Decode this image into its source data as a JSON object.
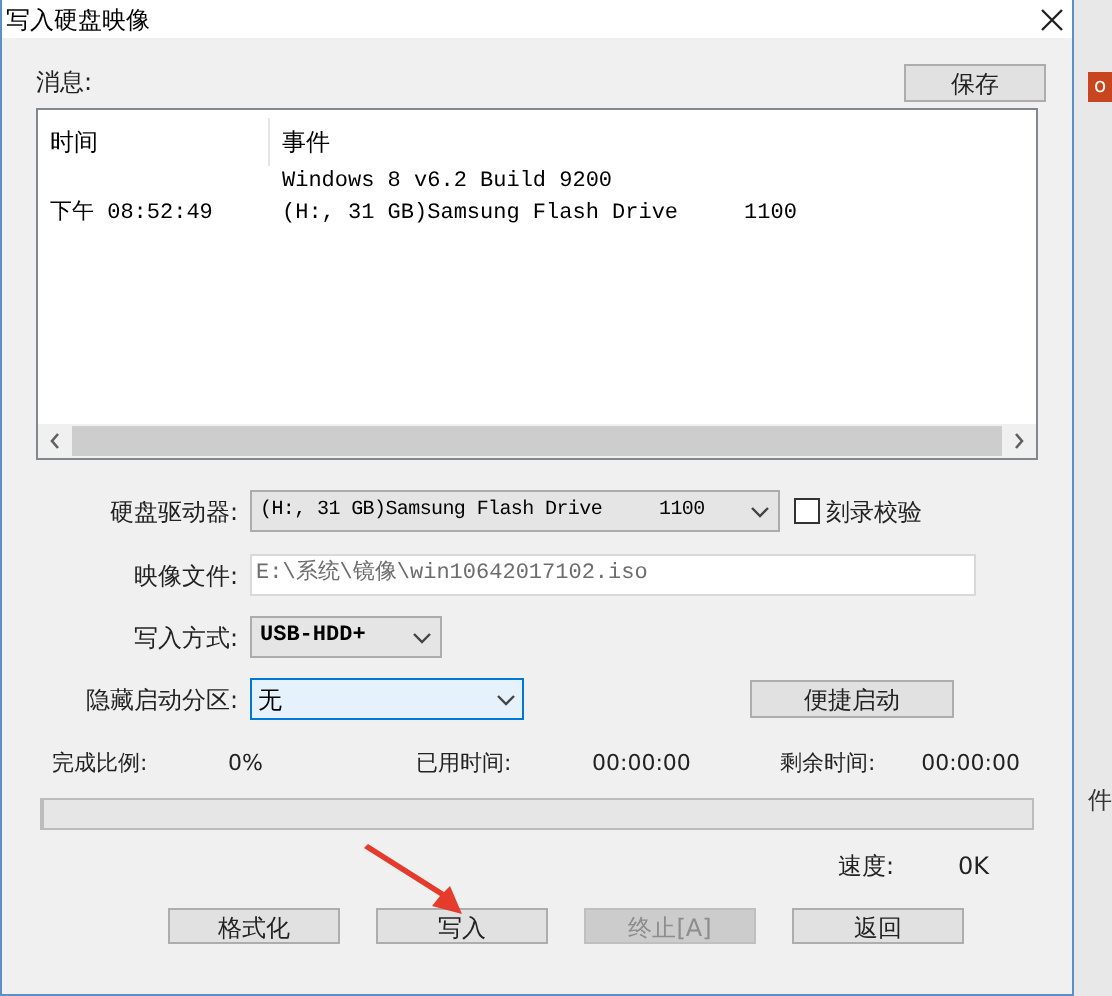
{
  "window": {
    "title": "写入硬盘映像"
  },
  "messages": {
    "label": "消息:",
    "save_button": "保存",
    "columns": [
      "时间",
      "事件"
    ],
    "rows": [
      {
        "time": "",
        "event": "Windows 8 v6.2 Build 9200"
      },
      {
        "time": "下午 08:52:49",
        "event": "(H:, 31 GB)Samsung Flash Drive     1100"
      }
    ]
  },
  "drive": {
    "label": "硬盘驱动器:",
    "value": "(H:, 31 GB)Samsung Flash Drive     1100"
  },
  "verify": {
    "label": "刻录校验",
    "checked": false
  },
  "image_file": {
    "label": "映像文件:",
    "value": "E:\\系统\\镜像\\win10642017102.iso"
  },
  "write_mode": {
    "label": "写入方式:",
    "value": "USB-HDD+"
  },
  "hidden_partition": {
    "label": "隐藏启动分区:",
    "value": "无"
  },
  "quick_boot_button": "便捷启动",
  "stats": [
    {
      "label": "完成比例:",
      "value": "0%"
    },
    {
      "label": "已用时间:",
      "value": "00:00:00"
    },
    {
      "label": "剩余时间:",
      "value": "00:00:00"
    }
  ],
  "progress": {
    "level": 0
  },
  "speed": {
    "label": "速度:",
    "value": "0K"
  },
  "buttons": [
    {
      "label": "格式化",
      "disabled": false
    },
    {
      "label": "写入",
      "disabled": false
    },
    {
      "label": "终止[A]",
      "disabled": true
    },
    {
      "label": "返回",
      "disabled": false
    }
  ],
  "background": {
    "badge": "o",
    "fragment": "件"
  }
}
